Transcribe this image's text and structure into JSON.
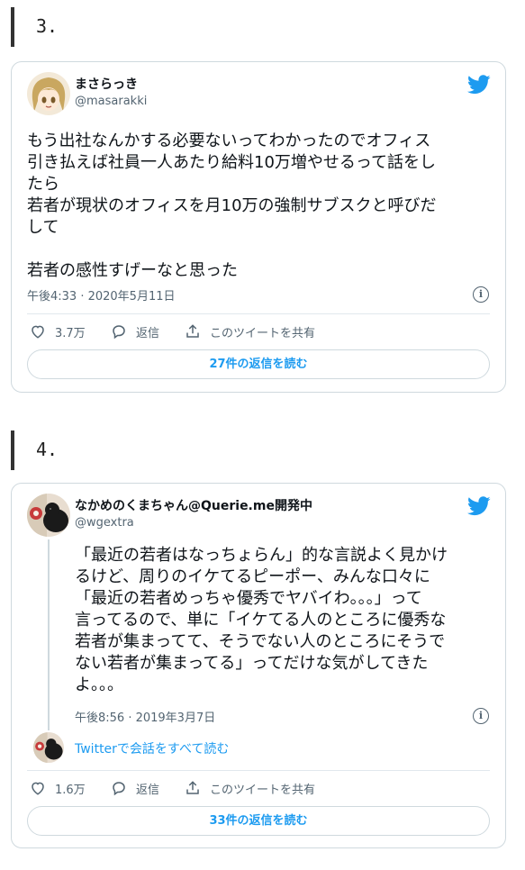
{
  "tweets": [
    {
      "section_number": "3.",
      "user_name": "まさらっき",
      "handle": "@masarakki",
      "text": "もう出社なんかする必要ないってわかったのでオフィス\n引き払えば社員一人あたり給料10万増やせるって話をし\nたら\n若者が現状のオフィスを月10万の強制サブスクと呼びだ\nして\n\n若者の感性すげーなと思った",
      "timestamp": "午後4:33 · 2020年5月11日",
      "likes": "3.7万",
      "reply_label": "返信",
      "share_label": "このツイートを共有",
      "replies_button": "27件の返信を読む"
    },
    {
      "section_number": "4.",
      "user_name": "なかめのくまちゃん@Querie.me開発中",
      "handle": "@wgextra",
      "text": "「最近の若者はなっちょらん」的な言説よく見かけ\nるけど、周りのイケてるピーポー、みんな口々に\n「最近の若者めっちゃ優秀でヤバイわ。。。」って\n言ってるので、単に「イケてる人のところに優秀な\n若者が集まってて、そうでない人のところにそうで\nない若者が集まってる」ってだけな気がしてきた\nよ。。。",
      "timestamp": "午後8:56 · 2019年3月7日",
      "thread_link": "Twitterで会話をすべて読む",
      "likes": "1.6万",
      "reply_label": "返信",
      "share_label": "このツイートを共有",
      "replies_button": "33件の返信を読む"
    }
  ],
  "colors": {
    "accent": "#1d9bf0",
    "text": "#0f1419",
    "muted": "#536471",
    "border": "#cfd9de"
  },
  "icons": [
    "twitter-bird-icon",
    "heart-icon",
    "speech-bubble-icon",
    "share-icon",
    "info-icon"
  ]
}
